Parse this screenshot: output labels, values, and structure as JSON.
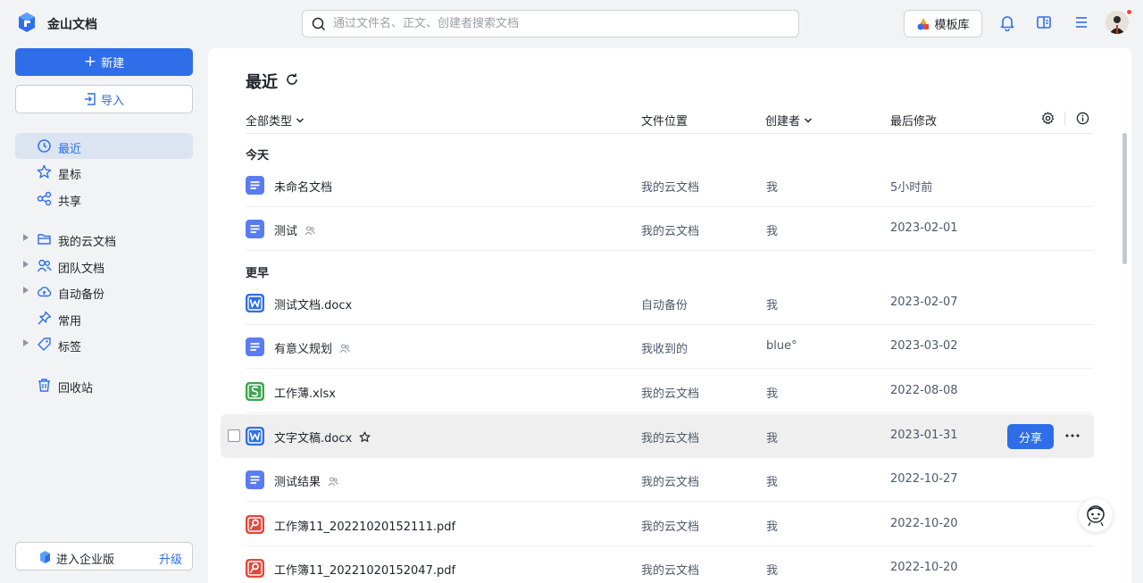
{
  "app": {
    "title": "金山文档"
  },
  "search": {
    "placeholder": "通过文件名、正文、创建者搜索文档"
  },
  "header": {
    "template_label": "模板库"
  },
  "sidebar": {
    "new_label": "新建",
    "import_label": "导入",
    "items": [
      {
        "label": "最近",
        "icon": "clock-icon",
        "active": true
      },
      {
        "label": "星标",
        "icon": "star-icon"
      },
      {
        "label": "共享",
        "icon": "share-icon"
      },
      {
        "label": "我的云文档",
        "icon": "folder-icon",
        "expandable": true
      },
      {
        "label": "团队文档",
        "icon": "team-icon",
        "expandable": true
      },
      {
        "label": "自动备份",
        "icon": "cloud-backup-icon",
        "expandable": true
      },
      {
        "label": "常用",
        "icon": "pin-icon"
      },
      {
        "label": "标签",
        "icon": "tag-icon",
        "expandable": true
      },
      {
        "label": "回收站",
        "icon": "trash-icon"
      }
    ],
    "enterprise_label": "进入企业版",
    "upgrade_label": "升级"
  },
  "main": {
    "title": "最近",
    "columns": {
      "type": "全部类型",
      "location": "文件位置",
      "creator": "创建者",
      "modified": "最后修改"
    },
    "groups": {
      "today": "今天",
      "earlier": "更早"
    },
    "rows": [
      {
        "name": "未命名文档",
        "type": "doc",
        "location": "我的云文档",
        "creator": "我",
        "modified": "5小时前",
        "shared": false
      },
      {
        "name": "测试",
        "type": "doc",
        "location": "我的云文档",
        "creator": "我",
        "modified": "2023-02-01",
        "shared": true
      },
      {
        "name": "测试文档.docx",
        "type": "word",
        "location": "自动备份",
        "creator": "我",
        "modified": "2023-02-07",
        "shared": false
      },
      {
        "name": "有意义规划",
        "type": "doc",
        "location": "我收到的",
        "creator": "blue°",
        "modified": "2023-03-02",
        "shared": true
      },
      {
        "name": "工作薄.xlsx",
        "type": "sheet",
        "location": "我的云文档",
        "creator": "我",
        "modified": "2022-08-08",
        "shared": false
      },
      {
        "name": "文字文稿.docx",
        "type": "word",
        "location": "我的云文档",
        "creator": "我",
        "modified": "2023-01-31",
        "shared": false,
        "hover": true
      },
      {
        "name": "测试结果",
        "type": "doc",
        "location": "我的云文档",
        "creator": "我",
        "modified": "2022-10-27",
        "shared": true
      },
      {
        "name": "工作簿11_20221020152111.pdf",
        "type": "pdf",
        "location": "我的云文档",
        "creator": "我",
        "modified": "2022-10-20",
        "shared": false
      },
      {
        "name": "工作簿11_20221020152047.pdf",
        "type": "pdf",
        "location": "我的云文档",
        "creator": "我",
        "modified": "2022-10-20",
        "shared": false
      }
    ],
    "share_label": "分享"
  },
  "colors": {
    "accent": "#2f6ee9",
    "doc": "#5b7cf0",
    "word": "#2f6ee9",
    "sheet": "#3aa64a",
    "pdf": "#e5463a"
  }
}
